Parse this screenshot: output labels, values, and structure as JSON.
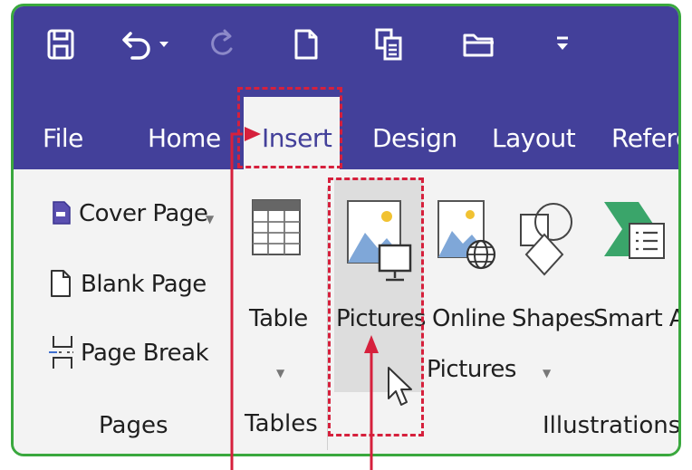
{
  "quick_access": [
    {
      "icon": "save-icon"
    },
    {
      "icon": "undo-icon"
    },
    {
      "icon": "redo-icon"
    },
    {
      "icon": "new-document-icon"
    },
    {
      "icon": "copy-format-icon"
    },
    {
      "icon": "open-folder-icon"
    },
    {
      "icon": "customize-toolbar-icon"
    }
  ],
  "tabs": [
    {
      "label": "File"
    },
    {
      "label": "Home"
    },
    {
      "label": "Insert",
      "active": true
    },
    {
      "label": "Design"
    },
    {
      "label": "Layout"
    },
    {
      "label": "Referer"
    }
  ],
  "groups": {
    "pages": {
      "label": "Pages",
      "items": [
        {
          "label": "Cover Page",
          "icon": "cover-page-icon",
          "dropdown": true
        },
        {
          "label": "Blank Page",
          "icon": "blank-page-icon"
        },
        {
          "label": "Page Break",
          "icon": "page-break-icon"
        }
      ]
    },
    "tables": {
      "label": "Tables",
      "items": [
        {
          "label": "Table",
          "icon": "table-icon",
          "dropdown": true
        }
      ]
    },
    "illustrations": {
      "label": "Illustrations",
      "items": [
        {
          "label": "Pictures",
          "icon": "pictures-icon",
          "highlighted": true
        },
        {
          "label_line1": "Online",
          "label_line2": "Pictures",
          "icon": "online-pictures-icon"
        },
        {
          "label": "Shapes",
          "icon": "shapes-icon",
          "dropdown": true
        },
        {
          "label": "Smart A",
          "icon": "smartart-icon"
        }
      ]
    }
  },
  "colors": {
    "title_bar": "#43409a",
    "ribbon_bg": "#f3f3f3",
    "annotation_red": "#d6203c",
    "frame_green": "#3aa83e"
  }
}
